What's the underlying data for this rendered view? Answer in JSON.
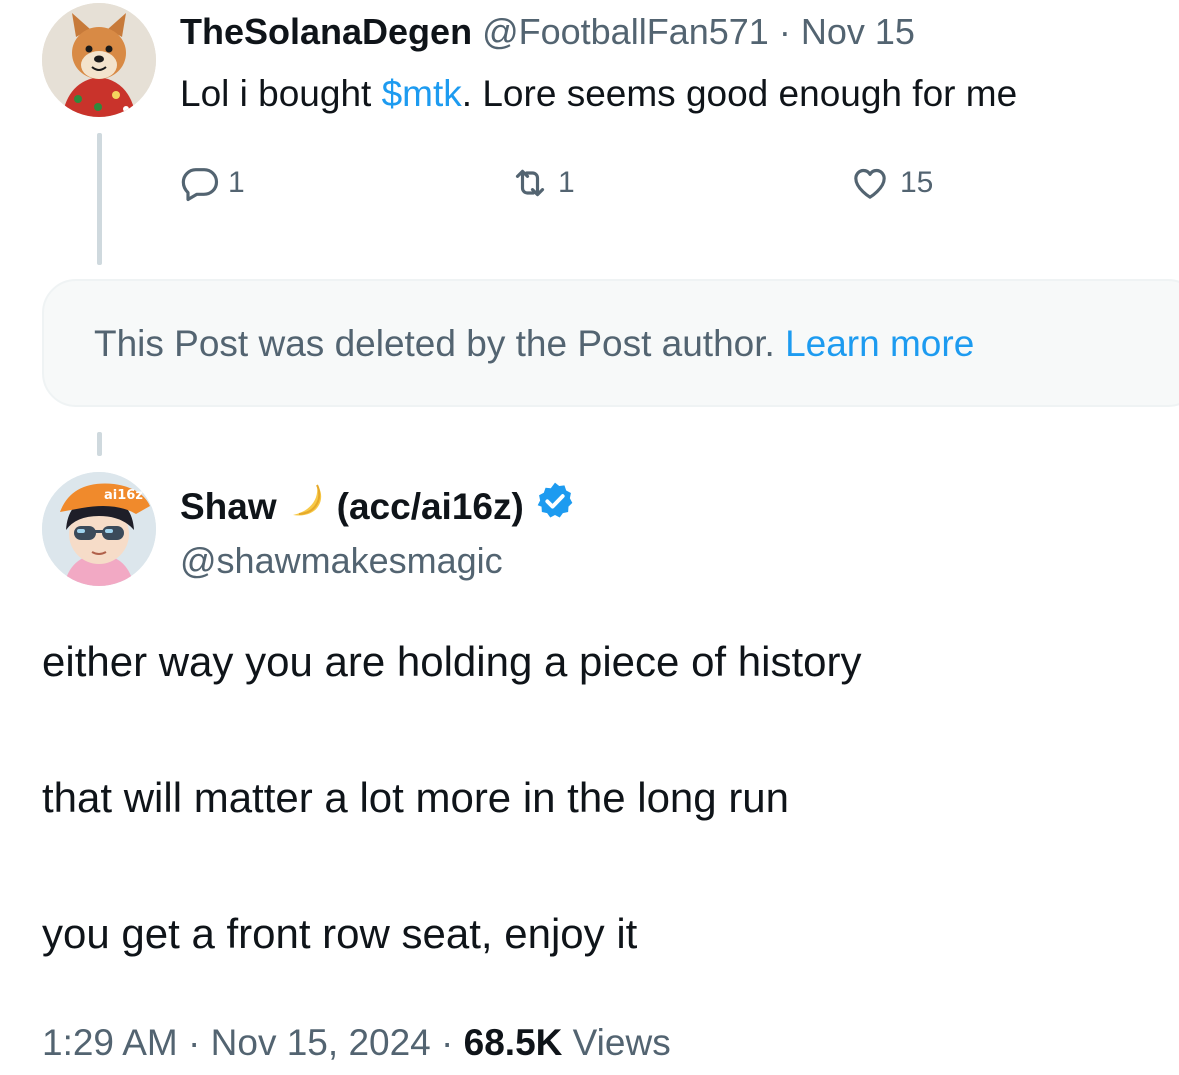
{
  "post1": {
    "display_name": "TheSolanaDegen",
    "handle": "@FootballFan571",
    "separator": "·",
    "date": "Nov 15",
    "text_before": "Lol i bought ",
    "cashtag": "$mtk",
    "text_after": ". Lore seems good enough for me",
    "replies": "1",
    "reposts": "1",
    "likes": "15"
  },
  "deleted_notice": {
    "text": "This Post was deleted by the Post author.",
    "link": "Learn more"
  },
  "post2": {
    "display_name": "Shaw",
    "display_suffix": "(acc/ai16z)",
    "handle": "@shawmakesmagic",
    "lines": [
      "either way you are holding a piece of history",
      "that will matter a lot more in the long run",
      "you get a front row seat, enjoy it"
    ],
    "time": "1:29 AM",
    "separator": "·",
    "date": "Nov 15, 2024",
    "views_count": "68.5K",
    "views_label": "Views",
    "avatar_badge_text": "ai16z"
  },
  "icons": [
    "reply-icon",
    "repost-icon",
    "like-icon",
    "verified-badge-icon",
    "moon-icon"
  ],
  "colors": {
    "accent": "#1d9bf0",
    "muted": "#536471",
    "text": "#0f1419",
    "notice_bg": "#f7f9f9"
  }
}
